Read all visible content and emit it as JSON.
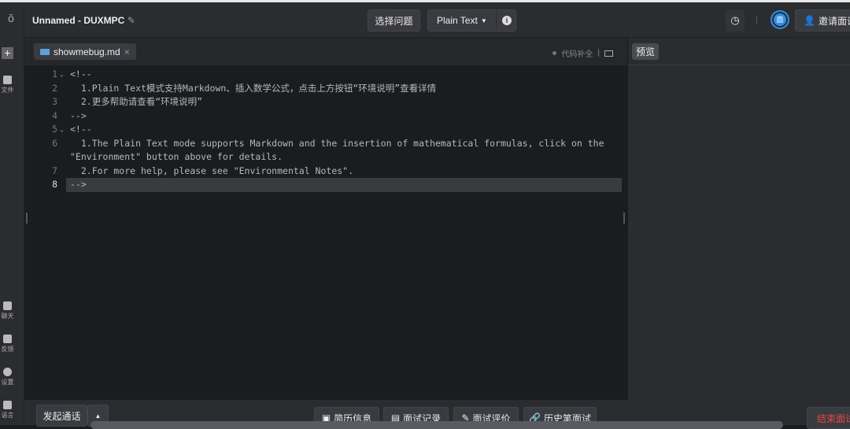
{
  "header": {
    "title": "Unnamed - DUXMPC",
    "select_question": "选择问题",
    "language": "Plain Text",
    "invite": "邀请面试",
    "avatar_text": "面"
  },
  "sidebar": {
    "items": [
      {
        "label": "文件",
        "icon": "folder-icon"
      },
      {
        "label": "聊天",
        "icon": "chat-icon"
      },
      {
        "label": "反馈",
        "icon": "feedback-icon"
      },
      {
        "label": "设置",
        "icon": "settings-icon"
      },
      {
        "label": "语言",
        "icon": "language-icon"
      }
    ]
  },
  "editor": {
    "file_tab": "showmebug.md",
    "autocomplete": "代码补全",
    "lines": [
      {
        "n": "1",
        "fold": true,
        "text": "<!--"
      },
      {
        "n": "2",
        "text": "  1.Plain Text模式支持Markdown、插入数学公式，点击上方按钮“环境说明”查看详情"
      },
      {
        "n": "3",
        "text": "  2.更多帮助请查看“环境说明”"
      },
      {
        "n": "4",
        "text": "-->"
      },
      {
        "n": "5",
        "fold": true,
        "text": "<!--"
      },
      {
        "n": "6",
        "text": "  1.The Plain Text mode supports Markdown and the insertion of mathematical formulas, click on the"
      },
      {
        "n": "",
        "text": "\"Environment\" button above for details."
      },
      {
        "n": "7",
        "text": "  2.For more help, please see \"Environmental Notes\"."
      },
      {
        "n": "8",
        "text": "-->",
        "active": true
      }
    ]
  },
  "preview": {
    "label": "预览"
  },
  "bottom": {
    "call": "发起通话",
    "resume": "简历信息",
    "record": "面试记录",
    "evaluation": "面试评价",
    "history": "历史笔面试",
    "end": "结束面试"
  },
  "colors": {
    "accent": "#2f8ee8",
    "end": "#e04848"
  }
}
